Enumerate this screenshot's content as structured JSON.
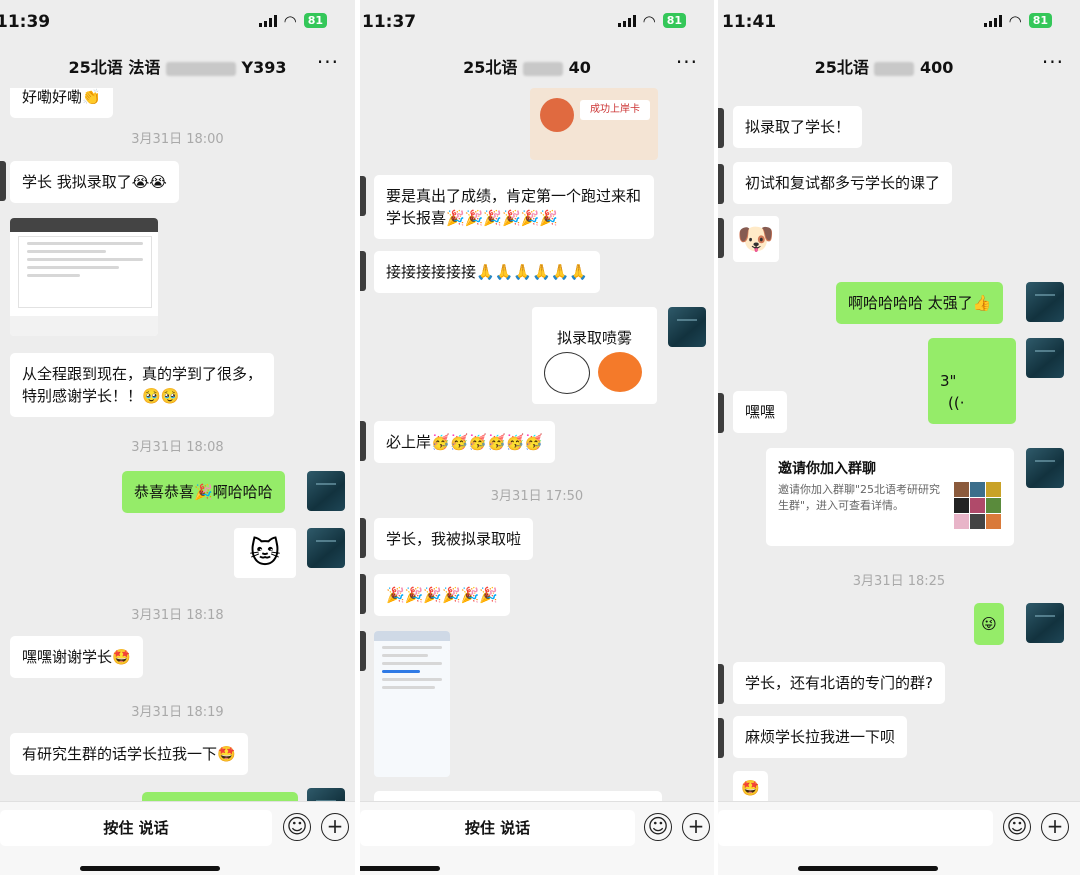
{
  "panels": [
    {
      "time": "11:39",
      "battery": "81",
      "title": "25北语 法语",
      "title_suffix": "Y393",
      "messages": [
        {
          "text": "好嘞好嘞👏"
        },
        {
          "ts": "3月31日 18:00"
        },
        {
          "text": "学长 我拟录取了😭😭"
        },
        {
          "text": "从全程跟到现在，真的学到了很多，特别感谢学长！！🥹🥹"
        },
        {
          "ts": "3月31日 18:08"
        },
        {
          "text": "恭喜恭喜🎉啊哈哈哈"
        },
        {
          "ts": "3月31日 18:18"
        },
        {
          "text": "嘿嘿谢谢学长🤩"
        },
        {
          "ts": "3月31日 18:19"
        },
        {
          "text": "有研究生群的话学长拉我一下🤩"
        }
      ],
      "sticker": "🐱",
      "voice_label": "按住 说话"
    },
    {
      "time": "11:37",
      "battery": "81",
      "title": "25北语",
      "title_suffix": "40",
      "messages": [
        {
          "text": "要是真出了成绩，肯定第一个跑过来和学长报喜🎉🎉🎉🎉🎉🎉"
        },
        {
          "text": "接接接接接接🙏🙏🙏🙏🙏🙏"
        },
        {
          "text": "必上岸🥳🥳🥳🥳🥳🥳"
        },
        {
          "ts": "3月31日 17:50"
        },
        {
          "text": "学长，我被拟录取啦"
        },
        {
          "text": "🎉🎉🎉🎉🎉🎉"
        }
      ],
      "card_sticker_text": "拟录取喷雾",
      "top_image_text": "成功上岸卡",
      "voice_label": "按住 说话"
    },
    {
      "time": "11:41",
      "battery": "81",
      "title": "25北语",
      "title_suffix": "400",
      "messages": [
        {
          "text": "拟录取了学长！"
        },
        {
          "text": "初试和复试都多亏学长的课了"
        },
        {
          "text": "啊哈哈哈哈 太强了👍"
        },
        {
          "text": "3\""
        },
        {
          "text": "嘿嘿"
        },
        {
          "ts": "3月31日 18:25"
        },
        {
          "text": "学长，还有北语的专门的群?"
        },
        {
          "text": "麻烦学长拉我进一下呗"
        }
      ],
      "invite_title": "邀请你加入群聊",
      "invite_desc": "邀请你加入群聊\"25北语考研研究生群\"，进入可查看详情。",
      "sticker": "🐶",
      "voice_label": ""
    }
  ]
}
